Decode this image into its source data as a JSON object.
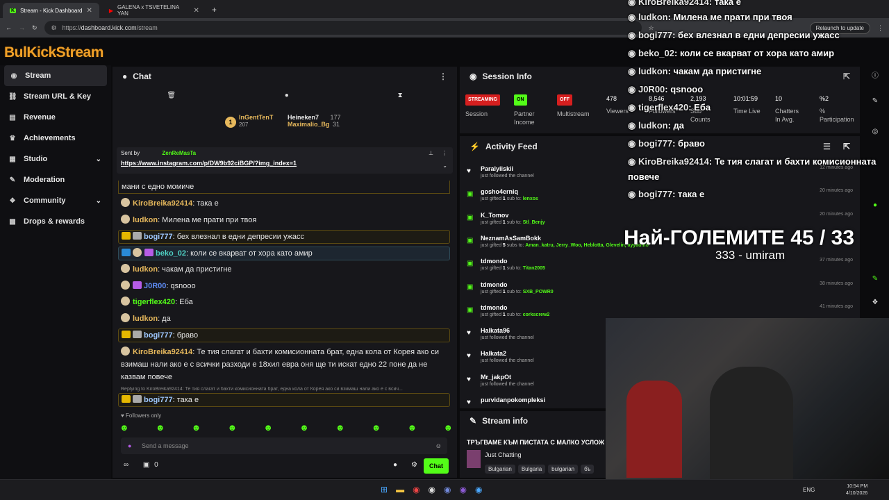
{
  "browser": {
    "tabs": [
      {
        "title": "Stream - Kick Dashboard"
      },
      {
        "title": "GALENA x TSVETELINA YAN"
      }
    ],
    "url_prefix": "https://",
    "url_host": "dashboard.kick.com",
    "url_path": "/stream",
    "relaunch_label": "Relaunch to update"
  },
  "app": {
    "logo": "BulKickStream"
  },
  "sidebar": {
    "items": [
      {
        "label": "Stream",
        "icon": "stream-icon"
      },
      {
        "label": "Stream URL & Key",
        "icon": "link-icon"
      },
      {
        "label": "Revenue",
        "icon": "revenue-icon"
      },
      {
        "label": "Achievements",
        "icon": "trophy-icon"
      },
      {
        "label": "Studio",
        "icon": "studio-icon"
      },
      {
        "label": "Moderation",
        "icon": "wrench-icon"
      },
      {
        "label": "Community",
        "icon": "community-icon"
      },
      {
        "label": "Drops & rewards",
        "icon": "drops-icon"
      }
    ]
  },
  "chat": {
    "title": "Chat",
    "leaders": [
      {
        "rank": "1",
        "name": "InGentTenT",
        "count": "207"
      },
      {
        "name": "Heineken7",
        "count": "177"
      },
      {
        "name": "Maximalio_Bg",
        "count": "31"
      }
    ],
    "pinned": {
      "sent_by_label": "Sent by",
      "sender": "ZenReMasTa",
      "link": "https://www.instagram.com/p/DW9b92ciBGP/?img_index=1"
    },
    "partial_top": "мани с едно момиче",
    "messages": [
      {
        "user": "KiroBreika92414",
        "text": ": така е",
        "color": "#e6b85c"
      },
      {
        "user": "ludkon",
        "text": ": Милена ме прати при твоя",
        "color": "#e6b85c"
      },
      {
        "user": "bogi777",
        "text": ": бех влезнал в едни депресии ужасс",
        "color": "#9ec8ff"
      },
      {
        "user": "beko_02",
        "text": ": коли се вкарват от хора като амир",
        "color": "#4fd1c5"
      },
      {
        "user": "ludkon",
        "text": ": чакам да пристигне",
        "color": "#e6b85c"
      },
      {
        "user": "J0R00",
        "text": ": qsnooo",
        "color": "#5d8bf4"
      },
      {
        "user": "tigerflex420",
        "text": ": Еба",
        "color": "#53fc18"
      },
      {
        "user": "ludkon",
        "text": ": да",
        "color": "#e6b85c"
      },
      {
        "user": "bogi777",
        "text": ": браво",
        "color": "#9ec8ff"
      },
      {
        "user": "KiroBreika92414",
        "text": ": Те тия слагат и бахти комисионната брат, една кола от Корея ако си взимаш нали ако е с всички разходи е 18хил евра оня ще ти искат едно 22 поне да не казвам повече",
        "color": "#e6b85c"
      }
    ],
    "reply_preview": "Replying to KiroBreika92414: Те тия слагат и бахти комисионната брат, една кола от Корея ако си взимаш нали ако е с всич...",
    "last_message": {
      "user": "bogi777",
      "text": ": така е"
    },
    "followers_only": "Followers only",
    "placeholder": "Send a message",
    "viewers_count": "0",
    "chat_button": "Chat"
  },
  "session": {
    "title": "Session Info",
    "stats": [
      {
        "value": "STREAMING",
        "label": "Session",
        "color": "#d61f1f"
      },
      {
        "value": "ON",
        "label": "Partner Income",
        "color": "#53fc18"
      },
      {
        "value": "OFF",
        "label": "Multistream",
        "color": "#d61f1f"
      },
      {
        "value": "478",
        "label": "Viewers"
      },
      {
        "value": "8,546",
        "label": "Followers"
      },
      {
        "value": "2,193",
        "label": "Sub Counts"
      },
      {
        "value": "10:01:59",
        "label": "Time Live"
      },
      {
        "value": "10",
        "label": "Chatters In Avg."
      },
      {
        "value": "%2",
        "label": "% Participation"
      }
    ]
  },
  "activity": {
    "title": "Activity Feed",
    "items": [
      {
        "name": "Paralyiiskii",
        "action": "just followed the channel",
        "time": "12 minutes ago",
        "type": "follow"
      },
      {
        "name": "gosho4erniq",
        "action": "just gifted",
        "count": "1",
        "suffix": "sub to:",
        "target": "lenxos",
        "time": "20 minutes ago",
        "type": "gift"
      },
      {
        "name": "K_Tomov",
        "action": "just gifted",
        "count": "1",
        "suffix": "sub to:",
        "target": "Stl_Benjy",
        "time": "20 minutes ago",
        "type": "gift"
      },
      {
        "name": "NeznamAsSamBokk",
        "action": "just gifted",
        "count": "5",
        "suffix": "subs to:",
        "target": "Aman_katru, Jerry_Woo, Heblotta, Glevelin, ayyadmo",
        "time": "",
        "type": "gift"
      },
      {
        "name": "tdmondo",
        "action": "just gifted",
        "count": "1",
        "suffix": "sub to:",
        "target": "Titan2005",
        "time": "37 minutes ago",
        "type": "gift"
      },
      {
        "name": "tdmondo",
        "action": "just gifted",
        "count": "1",
        "suffix": "sub to:",
        "target": "SXB_POWR0",
        "time": "38 minutes ago",
        "type": "gift"
      },
      {
        "name": "tdmondo",
        "action": "just gifted",
        "count": "1",
        "suffix": "sub to:",
        "target": "corkscrew2",
        "time": "41 minutes ago",
        "type": "gift"
      },
      {
        "name": "Halkata96",
        "action": "just followed the channel",
        "time": "",
        "type": "follow"
      },
      {
        "name": "Halkata2",
        "action": "just followed the channel",
        "time": "",
        "type": "follow"
      },
      {
        "name": "Mr_jakpOt",
        "action": "just followed the channel",
        "time": "",
        "type": "follow"
      },
      {
        "name": "purvidanpokompleksi",
        "action": "",
        "time": "",
        "type": "follow"
      }
    ]
  },
  "stream_info": {
    "title": "Stream info",
    "stream_title": "ТРЪГВАМЕ КЪМ ПИСТАТА С МАЛКО УСЛОЖ",
    "category": "Just Chatting",
    "tags": [
      "Bulgarian",
      "Bulgaria",
      "bulgarian",
      "бъ"
    ]
  },
  "overlay": {
    "messages": [
      {
        "user": "KiroBreika92414",
        "text": ": така е"
      },
      {
        "user": "ludkon",
        "text": ": Милена ме прати при твоя"
      },
      {
        "user": "bogi777",
        "text": ": бех влезнал в едни депресии ужасс"
      },
      {
        "user": "beko_02",
        "text": ": коли се вкарват от хора като амир"
      },
      {
        "user": "ludkon",
        "text": ": чакам да пристигне"
      },
      {
        "user": "J0R00",
        "text": ": qsnooo"
      },
      {
        "user": "tigerflex420",
        "text": ": Еба"
      },
      {
        "user": "ludkon",
        "text": ": да"
      },
      {
        "user": "bogi777",
        "text": ": браво"
      },
      {
        "user": "KiroBreika92414",
        "text": ": Те тия слагат и бахти комисионната"
      },
      {
        "user": "",
        "text": "повече"
      },
      {
        "user": "bogi777",
        "text": ": така е"
      }
    ],
    "big_title": "Най-ГОЛЕМИТЕ 45 / 33",
    "subtitle": "333 - umiram"
  },
  "taskbar": {
    "lang": "ENG",
    "time": "10:54 PM",
    "date": "4/10/2026"
  }
}
